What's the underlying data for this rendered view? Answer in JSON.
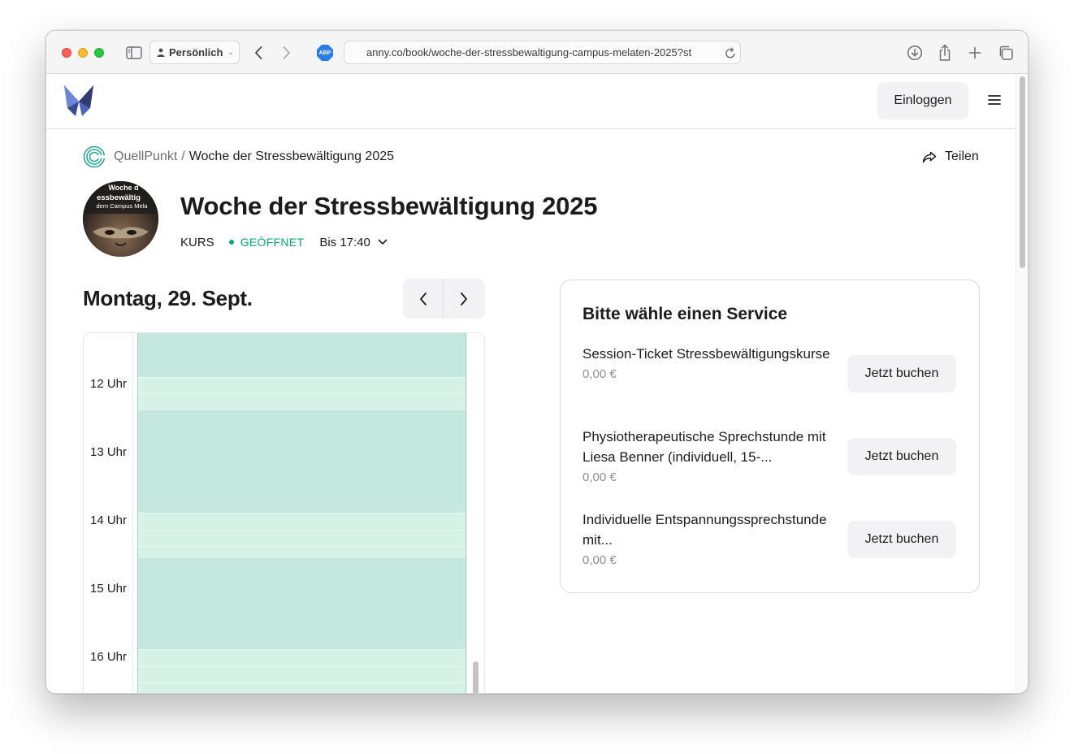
{
  "browser": {
    "profile_label": "Persönlich",
    "url": "anny.co/book/woche-der-stressbewaltigung-campus-melaten-2025?st",
    "abp_label": "ABP"
  },
  "header": {
    "login_label": "Einloggen"
  },
  "breadcrumb": {
    "organization": "QuellPunkt",
    "separator": "/",
    "current": "Woche der Stressbewältigung 2025"
  },
  "share_label": "Teilen",
  "event": {
    "avatar_text": [
      "Woche d",
      "essbewältig",
      "dem Campus Mela"
    ],
    "title": "Woche der Stressbewältigung 2025",
    "type": "KURS",
    "status": "GEÖFFNET",
    "until": "Bis 17:40"
  },
  "calendar": {
    "day_title": "Montag, 29. Sept.",
    "hours": [
      "12 Uhr",
      "13 Uhr",
      "14 Uhr",
      "15 Uhr",
      "16 Uhr"
    ]
  },
  "services": {
    "heading": "Bitte wähle einen Service",
    "items": [
      {
        "name": "Session-Ticket Stressbewältigungskurse",
        "price": "0,00 €",
        "button": "Jetzt buchen"
      },
      {
        "name": "Physiotherapeutische Sprechstunde mit Liesa Benner (individuell, 15-...",
        "price": "0,00 €",
        "button": "Jetzt buchen"
      },
      {
        "name": "Individuelle Entspannungssprechstunde mit...",
        "price": "0,00 €",
        "button": "Jetzt buchen"
      }
    ]
  },
  "colors": {
    "status_green": "#0aa872",
    "slot_available": "#d6f2e7",
    "slot_busy": "#c4e8df",
    "logo_blue": "#3b4a8c"
  }
}
